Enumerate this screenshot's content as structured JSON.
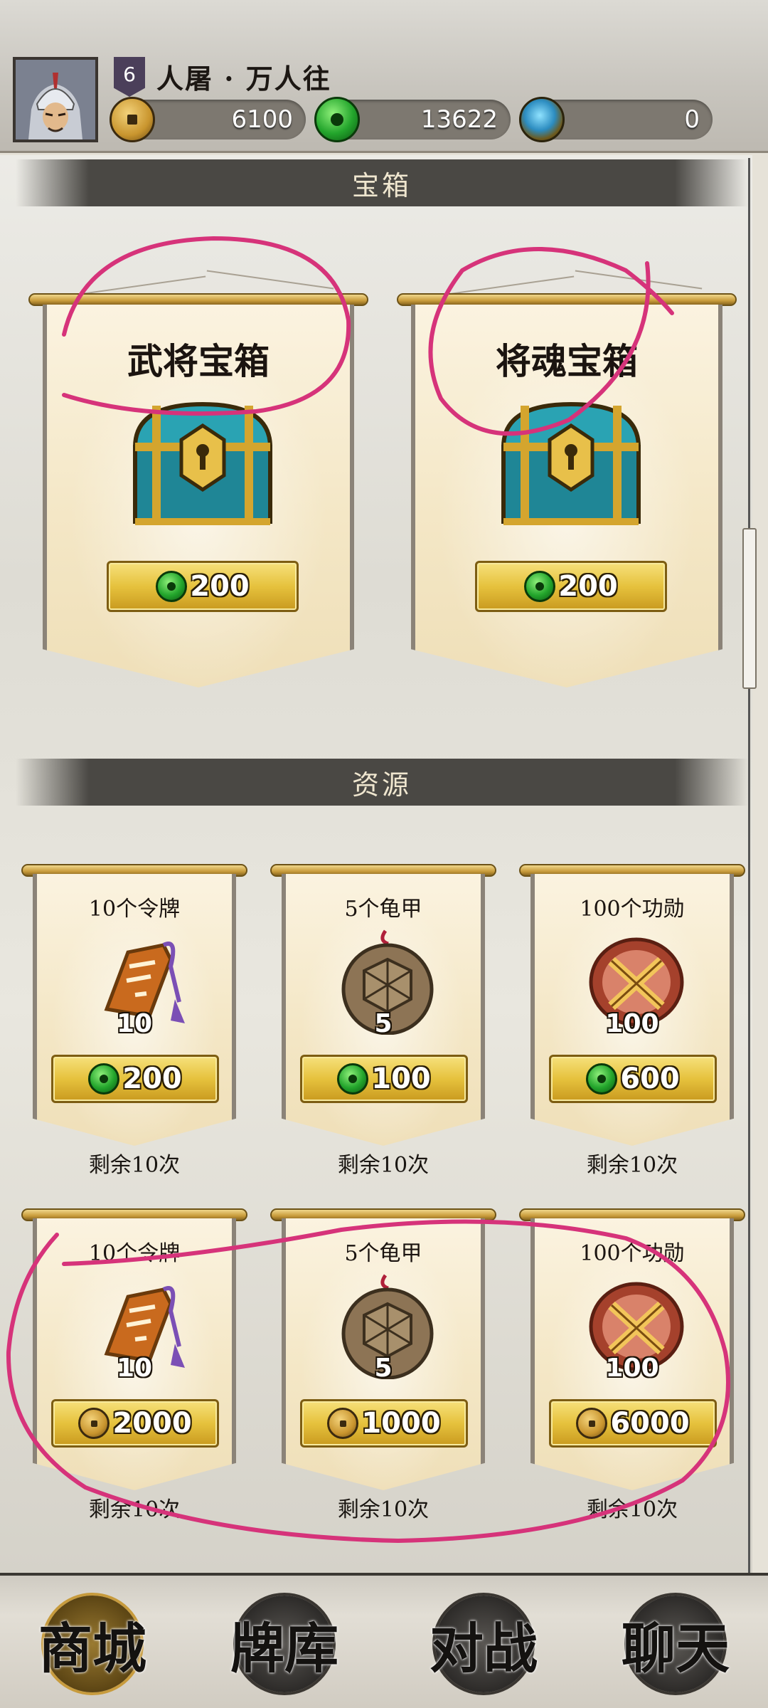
{
  "player": {
    "level": "6",
    "name": "人屠 · 万人往",
    "avatar_icon": "general-helmet-portrait"
  },
  "currencies": [
    {
      "name": "coin",
      "icon": "copper-coin-icon",
      "value": "6100"
    },
    {
      "name": "jade",
      "icon": "jade-coin-icon",
      "value": "13622"
    },
    {
      "name": "gem",
      "icon": "blue-gem-icon",
      "value": "0"
    }
  ],
  "sections": {
    "chests_title": "宝箱",
    "resources_title": "资源"
  },
  "chests": [
    {
      "title": "武将宝箱",
      "icon": "treasure-chest-icon",
      "price": "200",
      "currency_icon": "jade-coin-icon"
    },
    {
      "title": "将魂宝箱",
      "icon": "treasure-chest-icon",
      "price": "200",
      "currency_icon": "jade-coin-icon"
    }
  ],
  "resources_row1": [
    {
      "title": "10个令牌",
      "icon": "token-plaque-icon",
      "qty": "10",
      "price": "200",
      "currency_icon": "jade-coin-icon",
      "remain": "剩余10次"
    },
    {
      "title": "5个龟甲",
      "icon": "tortoise-shell-icon",
      "qty": "5",
      "price": "100",
      "currency_icon": "jade-coin-icon",
      "remain": "剩余10次"
    },
    {
      "title": "100个功勋",
      "icon": "crossed-swords-medal-icon",
      "qty": "100",
      "price": "600",
      "currency_icon": "jade-coin-icon",
      "remain": "剩余10次"
    }
  ],
  "resources_row2": [
    {
      "title": "10个令牌",
      "icon": "token-plaque-icon",
      "qty": "10",
      "price": "2000",
      "currency_icon": "copper-coin-icon",
      "remain": "剩余10次"
    },
    {
      "title": "5个龟甲",
      "icon": "tortoise-shell-icon",
      "qty": "5",
      "price": "1000",
      "currency_icon": "copper-coin-icon",
      "remain": "剩余10次"
    },
    {
      "title": "100个功勋",
      "icon": "crossed-swords-medal-icon",
      "qty": "100",
      "price": "6000",
      "currency_icon": "copper-coin-icon",
      "remain": "剩余10次"
    }
  ],
  "nav": [
    {
      "label": "商城",
      "active": true
    },
    {
      "label": "牌库",
      "active": false
    },
    {
      "label": "对战",
      "active": false
    },
    {
      "label": "聊天",
      "active": false
    }
  ],
  "colors": {
    "annotation": "#d6337a",
    "gold_button": "#e6c23d",
    "section_bar": "#4a4844"
  }
}
